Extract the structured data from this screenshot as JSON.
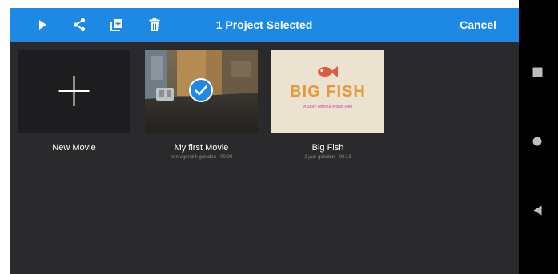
{
  "toolbar": {
    "title": "1 Project Selected",
    "cancel_label": "Cancel",
    "icons": [
      "play-icon",
      "share-icon",
      "duplicate-icon",
      "trash-icon"
    ],
    "accent_color": "#1e88e5"
  },
  "projects": [
    {
      "label": "New Movie",
      "subtitle": "",
      "selected": false
    },
    {
      "label": "My first Movie",
      "subtitle": "een ogenblik geleden - 00:00",
      "selected": true
    },
    {
      "label": "Big Fish",
      "subtitle": "2 jaar geleden - 00:13",
      "selected": false
    }
  ],
  "thumbnail": {
    "big_fish_title": "BIG FISH",
    "big_fish_tagline": "A Story Without Words Film"
  },
  "navbar": {
    "icons": [
      "recents-square-icon",
      "home-circle-icon",
      "back-triangle-icon"
    ]
  }
}
